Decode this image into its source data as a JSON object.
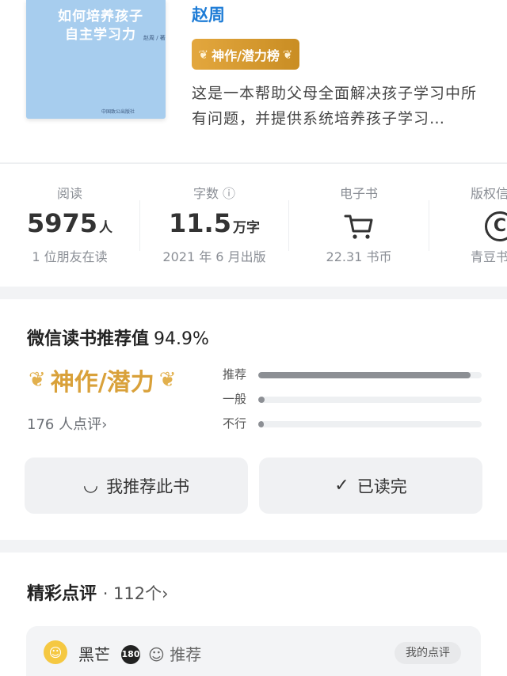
{
  "book": {
    "cover_title": "如何培养孩子自主学习力",
    "cover_author": "赵周 / 著",
    "cover_publisher": "中国致公出版社",
    "author": "赵周",
    "rank_badge": "神作/潜力榜",
    "description": "这是一本帮助父母全面解决孩子学习中所有问题，并提供系统培养孩子学习…"
  },
  "stats": {
    "reading": {
      "label": "阅读",
      "value": "5975",
      "unit": "人",
      "sub": "1 位朋友在读"
    },
    "words": {
      "label": "字数 ⓘ",
      "value": "11.5",
      "unit": "万字",
      "sub": "2021 年 6 月出版"
    },
    "ebook": {
      "label": "电子书",
      "icon": "cart-icon",
      "sub": "22.31 书币"
    },
    "copyright": {
      "label": "版权信",
      "icon": "copyright-icon",
      "sub": "青豆书"
    }
  },
  "recommend": {
    "title": "微信读书推荐值",
    "percent": "94.9%",
    "rank_label": "神作/潜力",
    "review_count": "176 人点评›",
    "bars": [
      {
        "label": "推荐",
        "value": 0.95
      },
      {
        "label": "一般",
        "value": 0.03
      },
      {
        "label": "不行",
        "value": 0.02
      }
    ],
    "btn_recommend": "我推荐此书",
    "btn_finished": "已读完"
  },
  "reviews": {
    "title": "精彩点评",
    "count": "· 112个›",
    "card": {
      "name": "黑芒",
      "level": "180",
      "tag": "☺ 推荐",
      "my_review": "我的点评"
    }
  },
  "colors": {
    "author_link": "#1e7cd6",
    "rank_gold": "#d9a13a",
    "cover_blue": "#a7cdee"
  }
}
